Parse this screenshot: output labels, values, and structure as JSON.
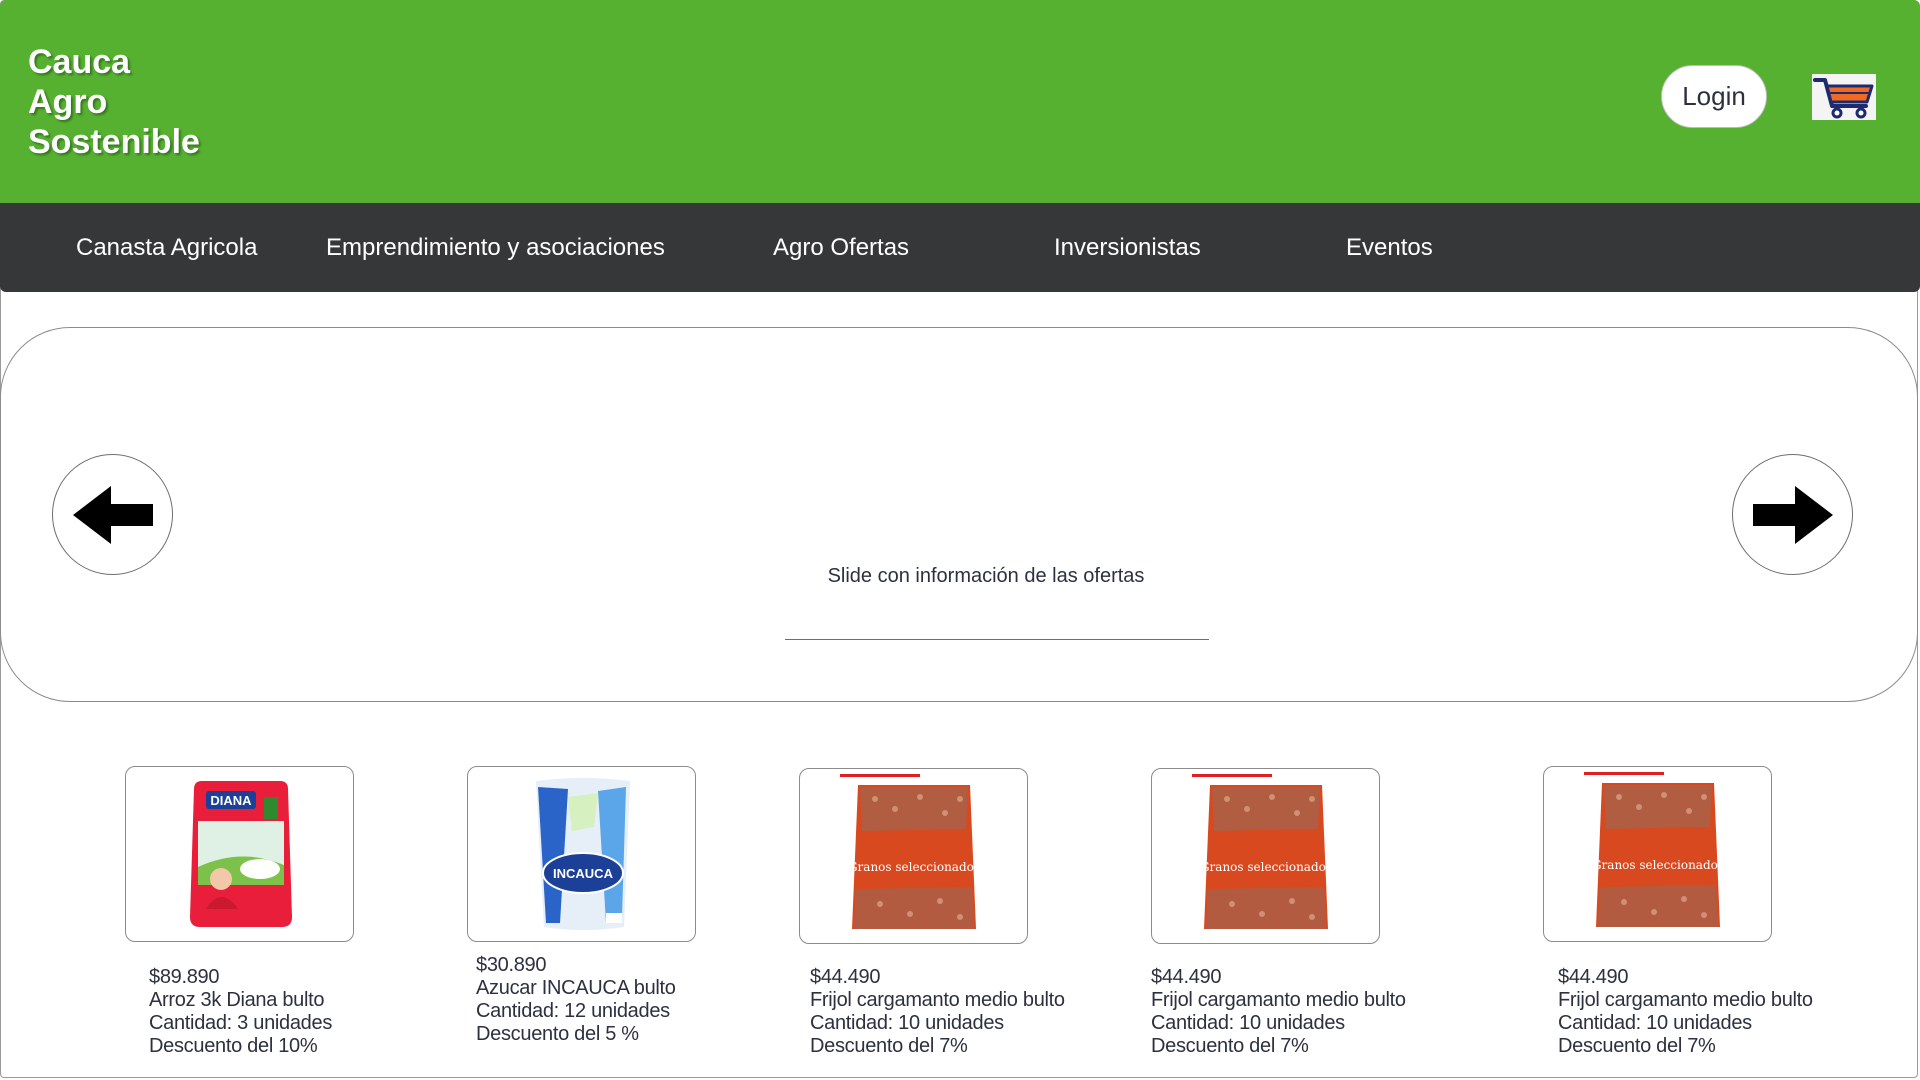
{
  "brand": {
    "name": "Cauca\nAgro\nSostenible"
  },
  "header": {
    "login_label": "Login",
    "cart_icon": "shopping-cart-icon"
  },
  "nav": {
    "items": [
      {
        "label": "Canasta Agricola"
      },
      {
        "label": "Emprendimiento y asociaciones"
      },
      {
        "label": "Agro Ofertas"
      },
      {
        "label": "Inversionistas"
      },
      {
        "label": "Eventos"
      }
    ]
  },
  "slider": {
    "text": "Slide con información de las ofertas",
    "prev_icon": "arrow-left-icon",
    "next_icon": "arrow-right-icon"
  },
  "products": [
    {
      "price": "$89.890",
      "name": "Arroz 3k Diana bulto",
      "quantity": "Cantidad: 3 unidades",
      "discount": "Descuento del 10%",
      "image_label": "DIANA"
    },
    {
      "price": "$30.890",
      "name": "Azucar INCAUCA bulto",
      "quantity": "Cantidad: 12 unidades",
      "discount": "Descuento del 5 %",
      "image_label": "INCAUCA"
    },
    {
      "price": "$44.490",
      "name": "Frijol cargamanto medio bulto",
      "quantity": "Cantidad: 10 unidades",
      "discount": "Descuento del 7%",
      "image_label": "Granos seleccionados"
    },
    {
      "price": "$44.490",
      "name": "Frijol cargamanto medio bulto",
      "quantity": "Cantidad: 10 unidades",
      "discount": "Descuento del 7%",
      "image_label": "Granos seleccionados"
    },
    {
      "price": "$44.490",
      "name": "Frijol cargamanto medio bulto",
      "quantity": "Cantidad: 10 unidades",
      "discount": "Descuento del 7%",
      "image_label": "Granos seleccionados"
    }
  ],
  "colors": {
    "header_bg": "#56b131",
    "nav_bg": "#353739",
    "text": "#2d3040"
  }
}
